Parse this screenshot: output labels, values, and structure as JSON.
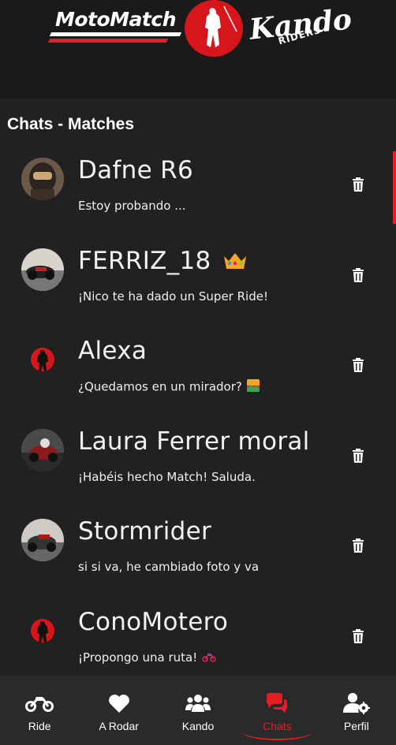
{
  "header": {
    "brand_left": "MotoMatch",
    "brand_right": "Kando",
    "brand_right_sub": "RIDERS"
  },
  "page_title": "Chats - Matches",
  "chats": [
    {
      "name": "Dafne R6",
      "message": "Estoy probando ...",
      "avatar": "photo-helmet-avatar",
      "badge": ""
    },
    {
      "name": "FERRIZ_18",
      "message": "¡Nico te ha dado un Super Ride!",
      "avatar": "photo-motorbike-avatar",
      "badge": "crown-icon"
    },
    {
      "name": "Alexa",
      "message": "¿Quedamos en un mirador?",
      "avatar": "kando-logo-avatar",
      "badge": "",
      "message_icon": "landscape-icon"
    },
    {
      "name": "Laura Ferrer moral",
      "message": "¡Habéis hecho Match! Saluda.",
      "avatar": "photo-motorbike-avatar",
      "badge": ""
    },
    {
      "name": "Stormrider",
      "message": "si si va, he cambiado foto y va",
      "avatar": "photo-motorbike-avatar",
      "badge": ""
    },
    {
      "name": "ConoMotero",
      "message": "¡Propongo una ruta!",
      "avatar": "kando-logo-avatar",
      "badge": "",
      "message_icon": "motorcycle-icon"
    }
  ],
  "nav": [
    {
      "label": "Ride",
      "icon": "motorcycle-icon",
      "active": false
    },
    {
      "label": "A Rodar",
      "icon": "heart-icon",
      "active": false
    },
    {
      "label": "Kando",
      "icon": "group-icon",
      "active": false
    },
    {
      "label": "Chats",
      "icon": "chat-icon",
      "active": true
    },
    {
      "label": "Perfil",
      "icon": "user-settings-icon",
      "active": false
    }
  ],
  "colors": {
    "accent": "#e31e24",
    "background": "#212121",
    "nav_background": "#2a2a2a"
  }
}
